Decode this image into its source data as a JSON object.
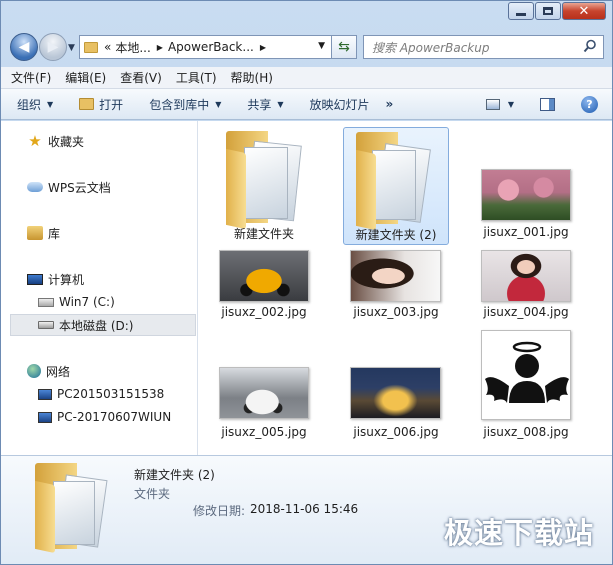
{
  "address": {
    "prefix": "«",
    "crumbs": [
      "本地...",
      "ApowerBack..."
    ]
  },
  "search": {
    "placeholder": "搜索 ApowerBackup"
  },
  "menubar": {
    "items": [
      "文件(F)",
      "编辑(E)",
      "查看(V)",
      "工具(T)",
      "帮助(H)"
    ]
  },
  "toolbar": {
    "organize": "组织",
    "open": "打开",
    "include_library": "包含到库中",
    "share": "共享",
    "slideshow": "放映幻灯片",
    "more": "»"
  },
  "sidebar": {
    "favorites": "收藏夹",
    "wps_cloud": "WPS云文档",
    "libraries": "库",
    "computer": "计算机",
    "drive_c": "Win7 (C:)",
    "drive_d": "本地磁盘 (D:)",
    "network": "网络",
    "net_pc1": "PC201503151538",
    "net_pc2": "PC-20170607WIUN"
  },
  "files": [
    {
      "name": "新建文件夹",
      "kind": "folder"
    },
    {
      "name": "新建文件夹 (2)",
      "kind": "folder",
      "selected": true
    },
    {
      "name": "jisuxz_001.jpg",
      "kind": "image"
    },
    {
      "name": "jisuxz_002.jpg",
      "kind": "image"
    },
    {
      "name": "jisuxz_003.jpg",
      "kind": "image"
    },
    {
      "name": "jisuxz_004.jpg",
      "kind": "image"
    },
    {
      "name": "jisuxz_005.jpg",
      "kind": "image"
    },
    {
      "name": "jisuxz_006.jpg",
      "kind": "image"
    },
    {
      "name": "jisuxz_008.jpg",
      "kind": "image"
    }
  ],
  "details": {
    "title": "新建文件夹 (2)",
    "type": "文件夹",
    "modified_label": "修改日期:",
    "modified_value": "2018-11-06 15:46"
  },
  "watermark": "极速下载站"
}
